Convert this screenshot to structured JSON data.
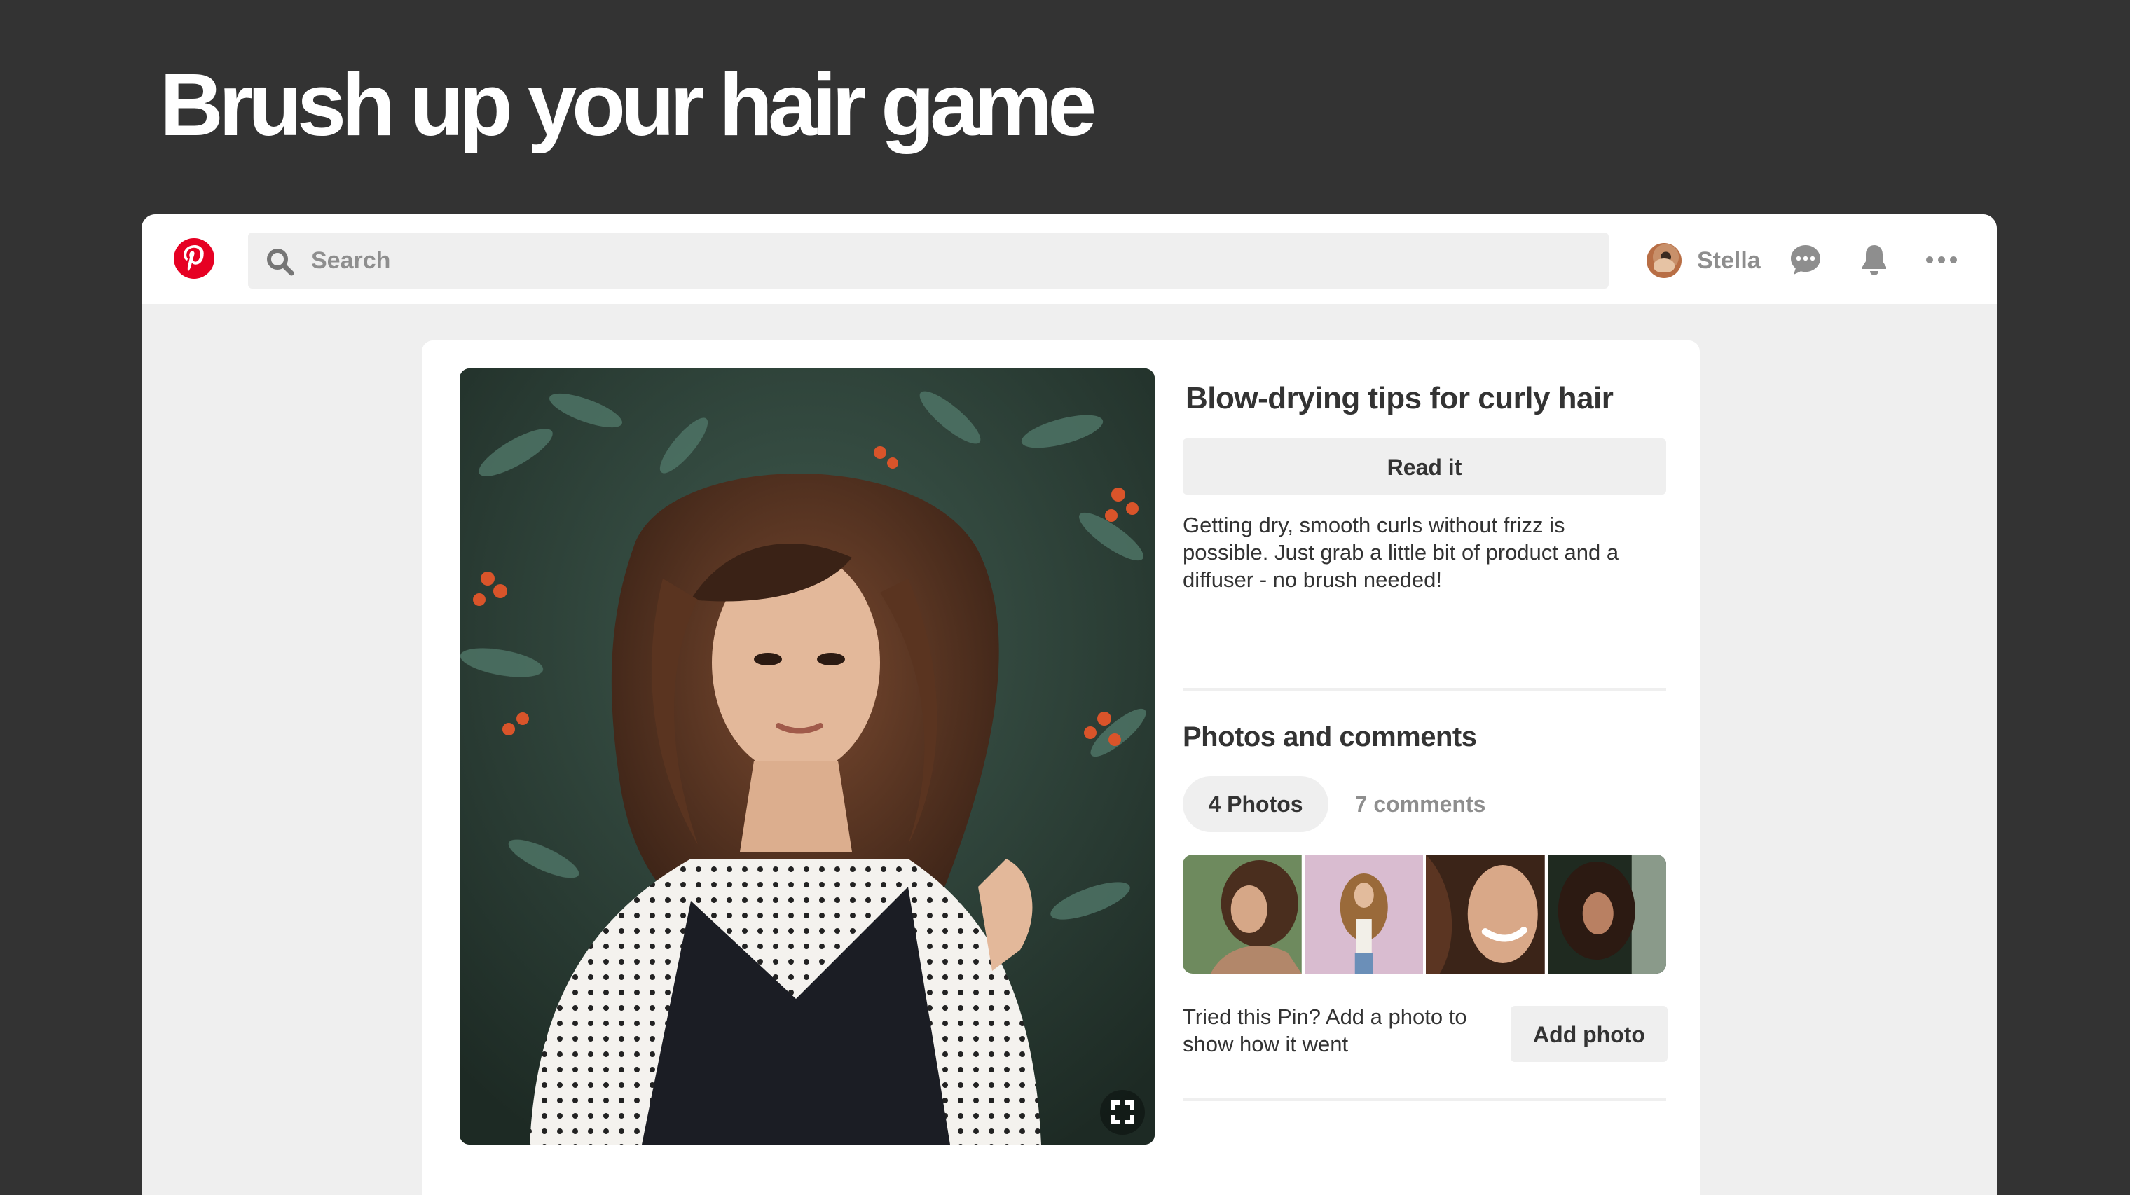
{
  "headline": "Brush up your hair game",
  "header": {
    "search_placeholder": "Search",
    "user_name": "Stella"
  },
  "pin": {
    "title": "Blow-drying tips for curly hair",
    "read_label": "Read it",
    "description": "Getting dry, smooth curls without frizz is possible. Just grab a little bit of product and a diffuser - no brush needed!"
  },
  "comments_section": {
    "title": "Photos and comments",
    "tabs": [
      {
        "label": "4 Photos",
        "selected": true
      },
      {
        "label": "7 comments",
        "selected": false
      }
    ],
    "tried_text": "Tried this Pin? Add a photo to show how it went",
    "add_photo_label": "Add photo"
  },
  "colors": {
    "background": "#333333",
    "brand_red": "#e60023",
    "panel": "#efefef",
    "text": "#333333",
    "muted_text": "#8e8e8e"
  }
}
